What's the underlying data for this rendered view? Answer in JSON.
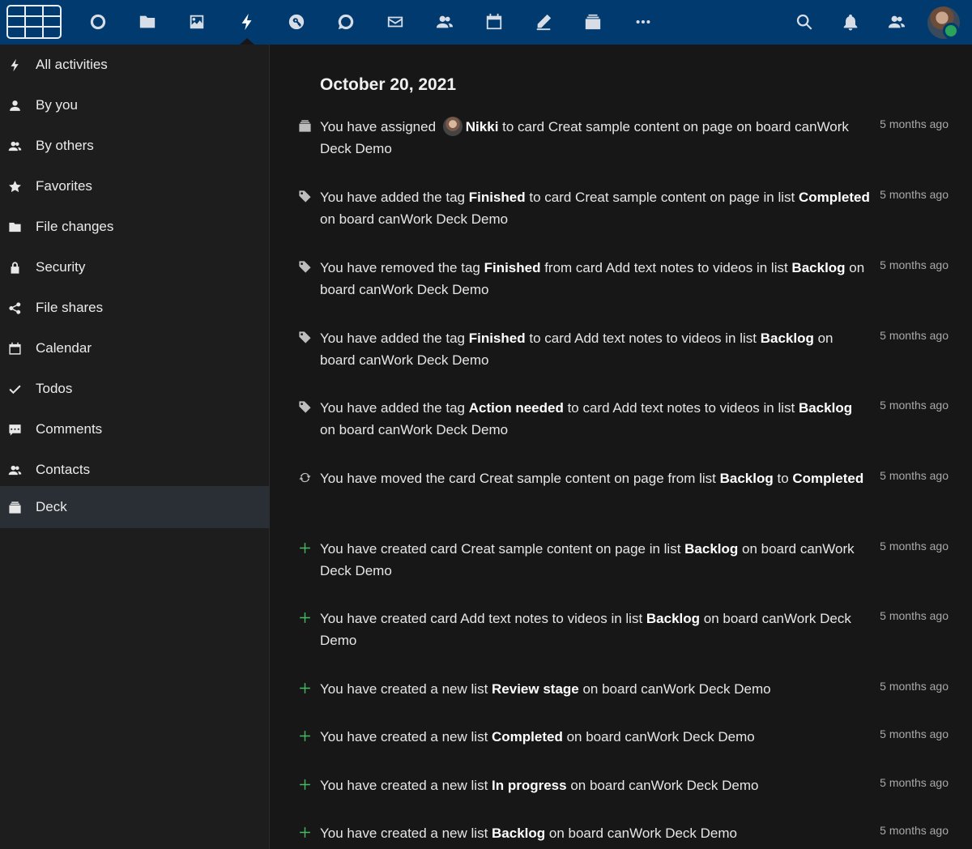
{
  "header": {
    "apps": [
      {
        "name": "dashboard-icon"
      },
      {
        "name": "files-icon"
      },
      {
        "name": "photos-icon"
      },
      {
        "name": "activity-icon"
      },
      {
        "name": "passwords-icon"
      },
      {
        "name": "talk-icon"
      },
      {
        "name": "mail-icon"
      },
      {
        "name": "contacts-icon"
      },
      {
        "name": "calendar-icon"
      },
      {
        "name": "notes-icon"
      },
      {
        "name": "deck-icon"
      },
      {
        "name": "more-apps-icon"
      }
    ],
    "active_app": "activity-icon",
    "accent": "#003a6e"
  },
  "sidebar": {
    "items": [
      {
        "label": "All activities",
        "icon": "lightning-icon"
      },
      {
        "label": "By you",
        "icon": "person-icon"
      },
      {
        "label": "By others",
        "icon": "people-icon"
      },
      {
        "label": "Favorites",
        "icon": "star-icon"
      },
      {
        "label": "File changes",
        "icon": "folder-icon"
      },
      {
        "label": "Security",
        "icon": "lock-icon"
      },
      {
        "label": "File shares",
        "icon": "share-icon"
      },
      {
        "label": "Calendar",
        "icon": "calendar-icon"
      },
      {
        "label": "Todos",
        "icon": "checkmark-icon"
      },
      {
        "label": "Comments",
        "icon": "comment-icon"
      },
      {
        "label": "Contacts",
        "icon": "contact-icon"
      },
      {
        "label": "Deck",
        "icon": "deck-icon"
      }
    ],
    "active": "Deck"
  },
  "main": {
    "date_heading": "October 20, 2021",
    "activities": [
      {
        "icon": "deck-icon",
        "parts": [
          {
            "t": "You have assigned "
          },
          {
            "avatar": true
          },
          {
            "t": "Nikki",
            "b": true
          },
          {
            "t": " to card Creat sample content on page on board canWork Deck Demo"
          }
        ],
        "time": "5 months ago"
      },
      {
        "icon": "tag-icon",
        "parts": [
          {
            "t": "You have added the tag "
          },
          {
            "t": "Finished",
            "b": true
          },
          {
            "t": " to card Creat sample content on page in list "
          },
          {
            "t": "Completed",
            "b": true
          },
          {
            "t": " on board canWork Deck Demo"
          }
        ],
        "time": "5 months ago"
      },
      {
        "icon": "tag-icon",
        "parts": [
          {
            "t": "You have removed the tag "
          },
          {
            "t": "Finished",
            "b": true
          },
          {
            "t": " from card Add text notes to videos in list "
          },
          {
            "t": "Backlog",
            "b": true
          },
          {
            "t": " on board canWork Deck Demo"
          }
        ],
        "time": "5 months ago"
      },
      {
        "icon": "tag-icon",
        "parts": [
          {
            "t": "You have added the tag "
          },
          {
            "t": "Finished",
            "b": true
          },
          {
            "t": " to card Add text notes to videos in list "
          },
          {
            "t": "Backlog",
            "b": true
          },
          {
            "t": " on board canWork Deck Demo"
          }
        ],
        "time": "5 months ago"
      },
      {
        "icon": "tag-icon",
        "parts": [
          {
            "t": "You have added the tag "
          },
          {
            "t": "Action needed",
            "b": true
          },
          {
            "t": " to card Add text notes to videos in list "
          },
          {
            "t": "Backlog",
            "b": true
          },
          {
            "t": " on board canWork Deck Demo"
          }
        ],
        "time": "5 months ago"
      },
      {
        "icon": "move-icon",
        "parts": [
          {
            "t": "You have moved the card Creat sample content on page from list "
          },
          {
            "t": "Backlog",
            "b": true
          },
          {
            "t": " to "
          },
          {
            "t": "Completed",
            "b": true
          }
        ],
        "time": "5 months ago"
      },
      {
        "icon": "plus-icon",
        "parts": [
          {
            "t": "You have created card Creat sample content on page in list "
          },
          {
            "t": "Backlog",
            "b": true
          },
          {
            "t": " on board canWork Deck Demo"
          }
        ],
        "time": "5 months ago"
      },
      {
        "icon": "plus-icon",
        "parts": [
          {
            "t": "You have created card Add text notes to videos in list "
          },
          {
            "t": "Backlog",
            "b": true
          },
          {
            "t": " on board canWork Deck Demo"
          }
        ],
        "time": "5 months ago"
      },
      {
        "icon": "plus-icon",
        "parts": [
          {
            "t": "You have created a new list "
          },
          {
            "t": "Review stage",
            "b": true
          },
          {
            "t": " on board canWork Deck Demo"
          }
        ],
        "time": "5 months ago"
      },
      {
        "icon": "plus-icon",
        "parts": [
          {
            "t": "You have created a new list "
          },
          {
            "t": "Completed",
            "b": true
          },
          {
            "t": " on board canWork Deck Demo"
          }
        ],
        "time": "5 months ago"
      },
      {
        "icon": "plus-icon",
        "parts": [
          {
            "t": "You have created a new list "
          },
          {
            "t": "In progress",
            "b": true
          },
          {
            "t": " on board canWork Deck Demo"
          }
        ],
        "time": "5 months ago"
      },
      {
        "icon": "plus-icon",
        "parts": [
          {
            "t": "You have created a new list "
          },
          {
            "t": "Backlog",
            "b": true
          },
          {
            "t": " on board canWork Deck Demo"
          }
        ],
        "time": "5 months ago"
      }
    ]
  },
  "colors": {
    "background": "#171717",
    "sidebar": "#1d1d1d",
    "active_item": "#2a2f35",
    "create_icon": "#46ba61",
    "status_online": "#2aa45a"
  }
}
